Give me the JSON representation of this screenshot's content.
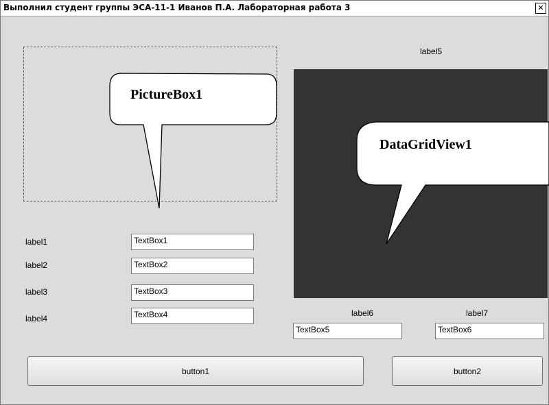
{
  "window": {
    "title": "Выполнил студент группы ЭСА-11-1 Иванов П.А. Лабораторная работа 3",
    "close_glyph": "✕"
  },
  "callouts": {
    "picturebox": "PictureBox1",
    "datagrid": "DataGridView1"
  },
  "labels": {
    "label1": "label1",
    "label2": "label2",
    "label3": "label3",
    "label4": "label4",
    "label5": "label5",
    "label6": "label6",
    "label7": "label7"
  },
  "textboxes": {
    "tb1": "TextBox1",
    "tb2": "TextBox2",
    "tb3": "TextBox3",
    "tb4": "TextBox4",
    "tb5": "TextBox5",
    "tb6": "TextBox6"
  },
  "buttons": {
    "button1": "button1",
    "button2": "button2"
  },
  "colors": {
    "form_bg": "#dcdcdc",
    "grid_bg": "#333333"
  }
}
